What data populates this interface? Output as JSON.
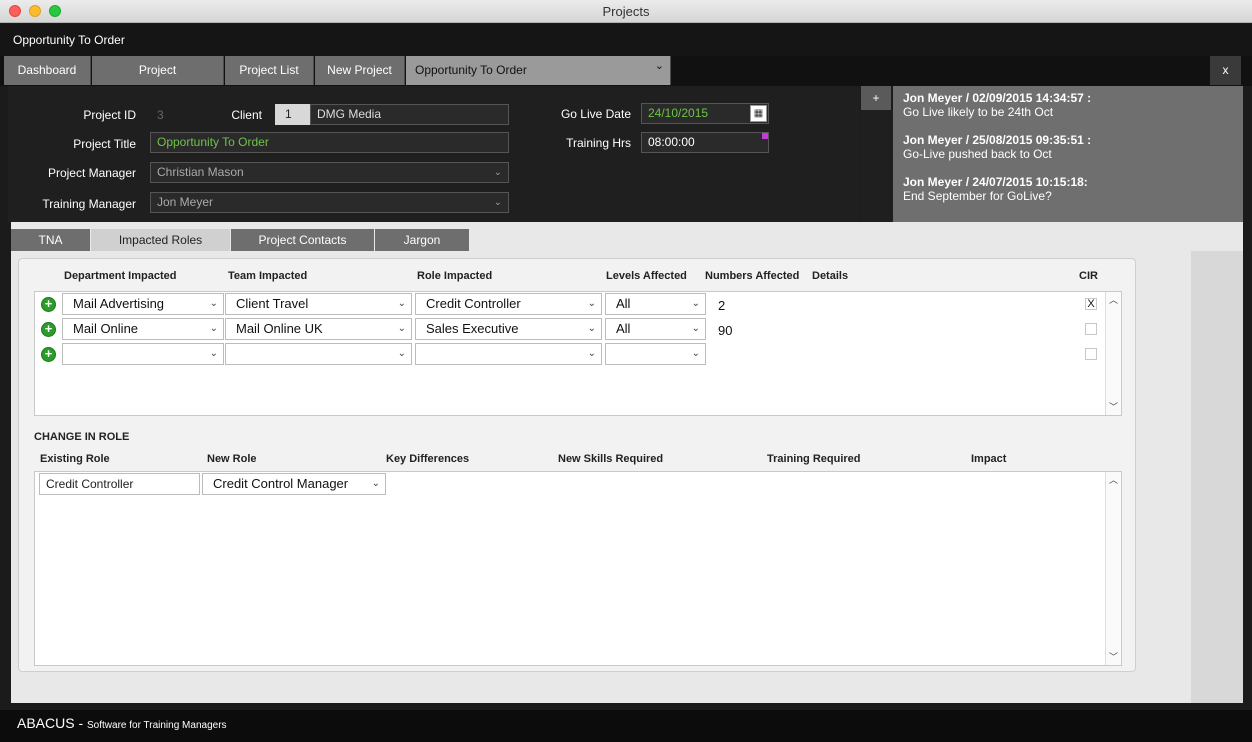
{
  "window": {
    "title": "Projects"
  },
  "app": {
    "title": "Opportunity To Order"
  },
  "nav": {
    "tabs": [
      "Dashboard",
      "Project",
      "Project List",
      "New Project",
      "Opportunity To Order"
    ],
    "close_label": "x"
  },
  "form": {
    "project_id_label": "Project ID",
    "project_id": "3",
    "client_label": "Client",
    "client_code": "1",
    "client_name": "DMG Media",
    "project_title_label": "Project Title",
    "project_title": "Opportunity To Order",
    "project_manager_label": "Project Manager",
    "project_manager": "Christian Mason",
    "training_manager_label": "Training Manager",
    "training_manager": "Jon Meyer",
    "go_live_label": "Go Live Date",
    "go_live": "24/10/2015",
    "training_hrs_label": "Training Hrs",
    "training_hrs": "08:00:00"
  },
  "notes": {
    "add_label": "+",
    "items": [
      {
        "header": "Jon Meyer / 02/09/2015 14:34:57 :",
        "text": "Go Live likely to be 24th Oct"
      },
      {
        "header": "Jon Meyer / 25/08/2015 09:35:51 :",
        "text": "Go-Live pushed back to Oct"
      },
      {
        "header": "Jon Meyer / 24/07/2015 10:15:18:",
        "text": "End September for GoLive?"
      }
    ]
  },
  "subtabs": [
    "TNA",
    "Impacted Roles",
    "Project Contacts",
    "Jargon"
  ],
  "roles": {
    "headers": [
      "Department Impacted",
      "Team Impacted",
      "Role Impacted",
      "Levels Affected",
      "Numbers Affected",
      "Details",
      "CIR"
    ],
    "rows": [
      {
        "department": "Mail Advertising",
        "team": "Client Travel",
        "role": "Credit Controller",
        "levels": "All",
        "numbers": "2",
        "cir": "X"
      },
      {
        "department": "Mail Online",
        "team": "Mail Online UK",
        "role": "Sales Executive",
        "levels": "All",
        "numbers": "90",
        "cir": ""
      },
      {
        "department": "",
        "team": "",
        "role": "",
        "levels": "",
        "numbers": "",
        "cir": ""
      }
    ]
  },
  "change": {
    "title": "CHANGE IN ROLE",
    "headers": [
      "Existing Role",
      "New Role",
      "Key Differences",
      "New Skills Required",
      "Training Required",
      "Impact"
    ],
    "existing_role": "Credit Controller",
    "new_role": "Credit Control Manager"
  },
  "footer": {
    "brand": "ABACUS - ",
    "tagline": "Software for Training Managers"
  }
}
